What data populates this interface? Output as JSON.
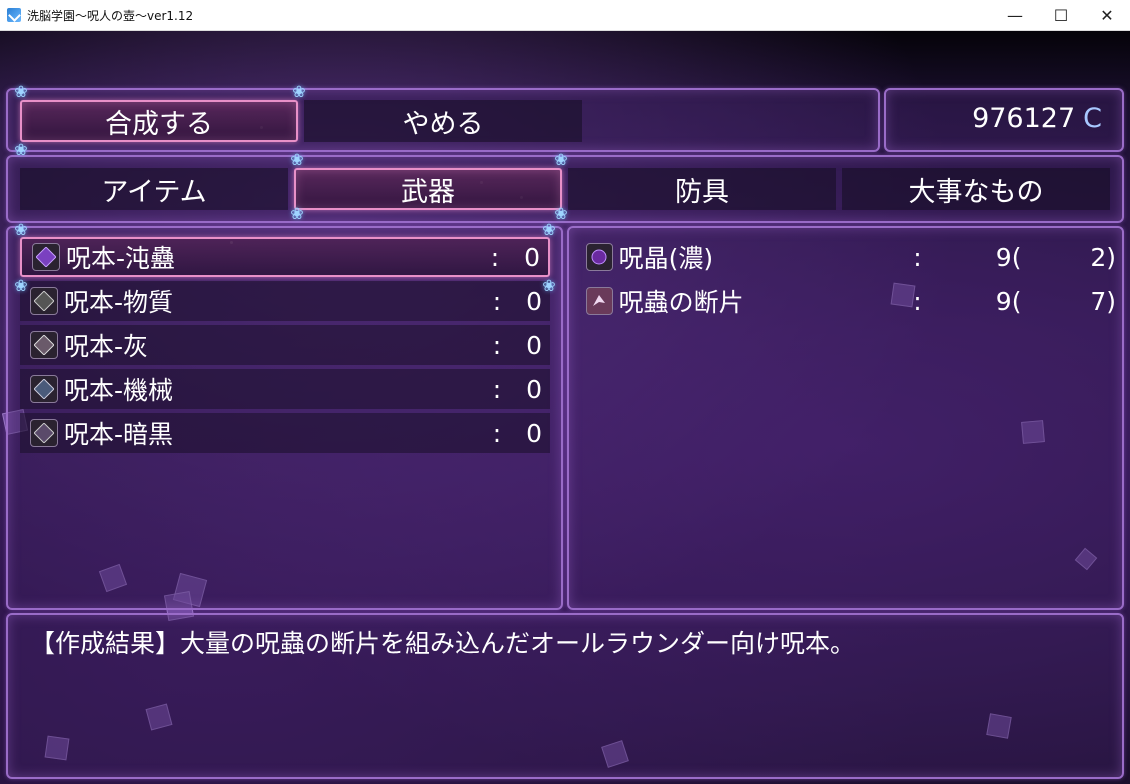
{
  "window": {
    "title": "洗脳学園～呪人の壺～ver1.12",
    "controls": {
      "minimize": "—",
      "maximize": "☐",
      "close": "✕"
    }
  },
  "commands": {
    "synthesize": "合成する",
    "cancel": "やめる"
  },
  "gold": {
    "amount": "976127",
    "unit": "C"
  },
  "categories": [
    {
      "label": "アイテム"
    },
    {
      "label": "武器"
    },
    {
      "label": "防具"
    },
    {
      "label": "大事なもの"
    }
  ],
  "recipes": [
    {
      "name": "呪本-沌蠱",
      "colon": ":",
      "count": "0"
    },
    {
      "name": "呪本-物質",
      "colon": ":",
      "count": "0"
    },
    {
      "name": "呪本-灰",
      "colon": ":",
      "count": "0"
    },
    {
      "name": "呪本-機械",
      "colon": ":",
      "count": "0"
    },
    {
      "name": "呪本-暗黒",
      "colon": ":",
      "count": "0"
    }
  ],
  "materials": [
    {
      "name": "呪晶(濃)",
      "colon": ":",
      "have": "9(",
      "need": "2)"
    },
    {
      "name": "呪蟲の断片",
      "colon": ":",
      "have": "9(",
      "need": "7)"
    }
  ],
  "description": "【作成結果】大量の呪蟲の断片を組み込んだオールラウンダー向け呪本。",
  "colors": {
    "accent_border": "#9a6cc8",
    "selected_border": "#e890c8",
    "currency_unit": "#a8c8ff"
  }
}
